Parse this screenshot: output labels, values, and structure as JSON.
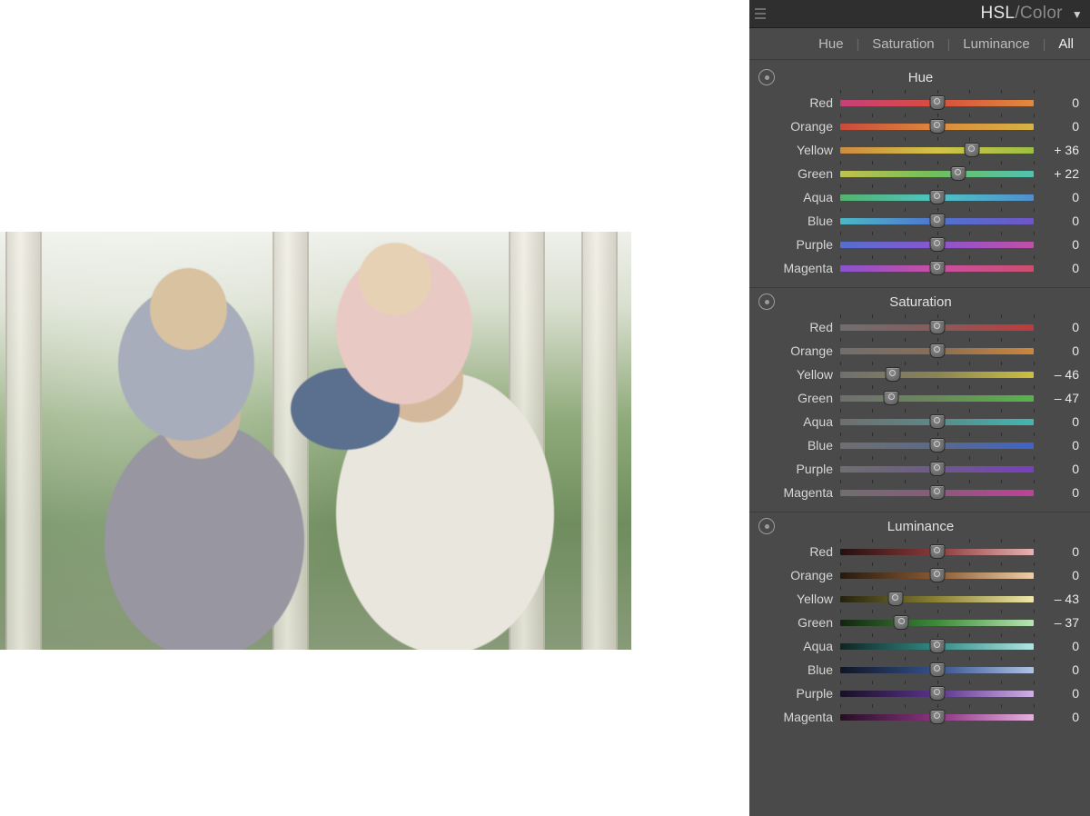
{
  "panel": {
    "title_left": "HSL",
    "title_sep": " / ",
    "title_right": "Color",
    "tabs": [
      "Hue",
      "Saturation",
      "Luminance",
      "All"
    ],
    "active_tab": 3,
    "sections": [
      {
        "title": "Hue",
        "rows": [
          {
            "label": "Red",
            "value": 0,
            "display": "0",
            "grad": [
              "#c73f7a",
              "#d84e3e",
              "#e08a3d"
            ]
          },
          {
            "label": "Orange",
            "value": 0,
            "display": "0",
            "grad": [
              "#c94a3a",
              "#dc8a3c",
              "#d6b346"
            ]
          },
          {
            "label": "Yellow",
            "value": 36,
            "display": "+ 36",
            "grad": [
              "#cf8a3f",
              "#d2c347",
              "#9bbf45"
            ]
          },
          {
            "label": "Green",
            "value": 22,
            "display": "+ 22",
            "grad": [
              "#c2c24a",
              "#6fbf5d",
              "#4fc3b3"
            ]
          },
          {
            "label": "Aqua",
            "value": 0,
            "display": "0",
            "grad": [
              "#55b36d",
              "#4fc3c3",
              "#4f8fd0"
            ]
          },
          {
            "label": "Blue",
            "value": 0,
            "display": "0",
            "grad": [
              "#4cb8c6",
              "#4f74cf",
              "#6f55c9"
            ]
          },
          {
            "label": "Purple",
            "value": 0,
            "display": "0",
            "grad": [
              "#536fd0",
              "#8a55cf",
              "#c24fa6"
            ]
          },
          {
            "label": "Magenta",
            "value": 0,
            "display": "0",
            "grad": [
              "#8a52cf",
              "#c94fa2",
              "#cc4f6e"
            ]
          }
        ]
      },
      {
        "title": "Saturation",
        "rows": [
          {
            "label": "Red",
            "value": 0,
            "display": "0",
            "grad": [
              "#6f6f6f",
              "#8a5a5a",
              "#c03a3a"
            ]
          },
          {
            "label": "Orange",
            "value": 0,
            "display": "0",
            "grad": [
              "#6f6f6f",
              "#8a6e55",
              "#cf863a"
            ]
          },
          {
            "label": "Yellow",
            "value": -46,
            "display": "– 46",
            "grad": [
              "#6f6f6f",
              "#8a8455",
              "#cdc03d"
            ]
          },
          {
            "label": "Green",
            "value": -47,
            "display": "– 47",
            "grad": [
              "#6f6f6f",
              "#6a8a5a",
              "#56b549"
            ]
          },
          {
            "label": "Aqua",
            "value": 0,
            "display": "0",
            "grad": [
              "#6f6f6f",
              "#5a8a88",
              "#3fb8b3"
            ]
          },
          {
            "label": "Blue",
            "value": 0,
            "display": "0",
            "grad": [
              "#6f6f6f",
              "#5a6a8a",
              "#3f63c9"
            ]
          },
          {
            "label": "Purple",
            "value": 0,
            "display": "0",
            "grad": [
              "#6f6f6f",
              "#6e5a8a",
              "#7a3fc2"
            ]
          },
          {
            "label": "Magenta",
            "value": 0,
            "display": "0",
            "grad": [
              "#6f6f6f",
              "#8a5a7c",
              "#c23f9a"
            ]
          }
        ]
      },
      {
        "title": "Luminance",
        "rows": [
          {
            "label": "Red",
            "value": 0,
            "display": "0",
            "grad": [
              "#241010",
              "#8a3a3a",
              "#e6b3b3"
            ]
          },
          {
            "label": "Orange",
            "value": 0,
            "display": "0",
            "grad": [
              "#241a10",
              "#8a5a34",
              "#edd0a8"
            ]
          },
          {
            "label": "Yellow",
            "value": -43,
            "display": "– 43",
            "grad": [
              "#242210",
              "#8a8234",
              "#efe8a8"
            ]
          },
          {
            "label": "Green",
            "value": -37,
            "display": "– 37",
            "grad": [
              "#122410",
              "#3f8a3a",
              "#b9e6b3"
            ]
          },
          {
            "label": "Aqua",
            "value": 0,
            "display": "0",
            "grad": [
              "#102422",
              "#348a86",
              "#b0e6e2"
            ]
          },
          {
            "label": "Blue",
            "value": 0,
            "display": "0",
            "grad": [
              "#101624",
              "#34528a",
              "#b0c3e6"
            ]
          },
          {
            "label": "Purple",
            "value": 0,
            "display": "0",
            "grad": [
              "#181024",
              "#5a348a",
              "#cfb0e6"
            ]
          },
          {
            "label": "Magenta",
            "value": 0,
            "display": "0",
            "grad": [
              "#241022",
              "#8a3480",
              "#e6b0df"
            ]
          }
        ]
      }
    ]
  }
}
